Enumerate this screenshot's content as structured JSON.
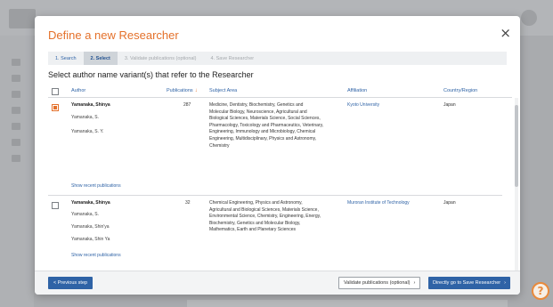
{
  "modal": {
    "title": "Define a new Researcher",
    "close_icon": "close-icon",
    "steps": [
      {
        "label": "1. Search",
        "state": "done"
      },
      {
        "label": "2. Select",
        "state": "active"
      },
      {
        "label": "3. Validate publications (optional)",
        "state": "dim"
      },
      {
        "label": "4. Save Researcher",
        "state": "dim"
      }
    ],
    "instruction": "Select author name variant(s) that refer to the Researcher"
  },
  "table": {
    "headers": {
      "author": "Author",
      "publications": "Publications",
      "subject_area": "Subject Area",
      "affiliation": "Affiliation",
      "country": "Country/Region"
    },
    "sort_icon": "sort-down-arrow-icon",
    "rows": [
      {
        "checked": true,
        "author": "Yamanaka, Shinya",
        "variants": [
          "Yamanaka, S.",
          "Yamanaka, S. Y."
        ],
        "publications": "287",
        "subject_lines": [
          "Medicine, Dentistry, Biochemistry, Genetics and",
          "Molecular Biology, Neuroscience, Agricultural and",
          "Biological Sciences, Materials Science, Social Sciences,",
          "Pharmacology, Toxicology and Pharmaceutics, Veterinary,",
          "Engineering, Immunology and Microbiology, Chemical",
          "Engineering, Multidisciplinary, Physics and Astronomy,",
          "Chemistry"
        ],
        "affiliation": "Kyoto University",
        "country": "Japan",
        "recent_link": "Show recent publications"
      },
      {
        "checked": false,
        "author": "Yamanaka, Shinya",
        "variants": [
          "Yamanaka, S.",
          "Yamanaka, Shin'ya",
          "Yamanaka, Shin Ya"
        ],
        "publications": "32",
        "subject_lines": [
          "Chemical Engineering, Physics and Astronomy,",
          "Agricultural and Biological Sciences, Materials Science,",
          "Environmental Science, Chemistry, Engineering, Energy,",
          "Biochemistry, Genetics and Molecular Biology,",
          "Mathematics, Earth and Planetary Sciences"
        ],
        "affiliation": "Muroran Institute of Technology",
        "country": "Japan",
        "recent_link": "Show recent publications"
      }
    ]
  },
  "footer": {
    "previous": "< Previous step",
    "validate": "Validate publications (optional)",
    "direct": "Directly go to Save Researcher",
    "chevron_icon": "chevron-right-icon"
  },
  "colors": {
    "accent": "#e4712b",
    "primary": "#2f63a6"
  }
}
